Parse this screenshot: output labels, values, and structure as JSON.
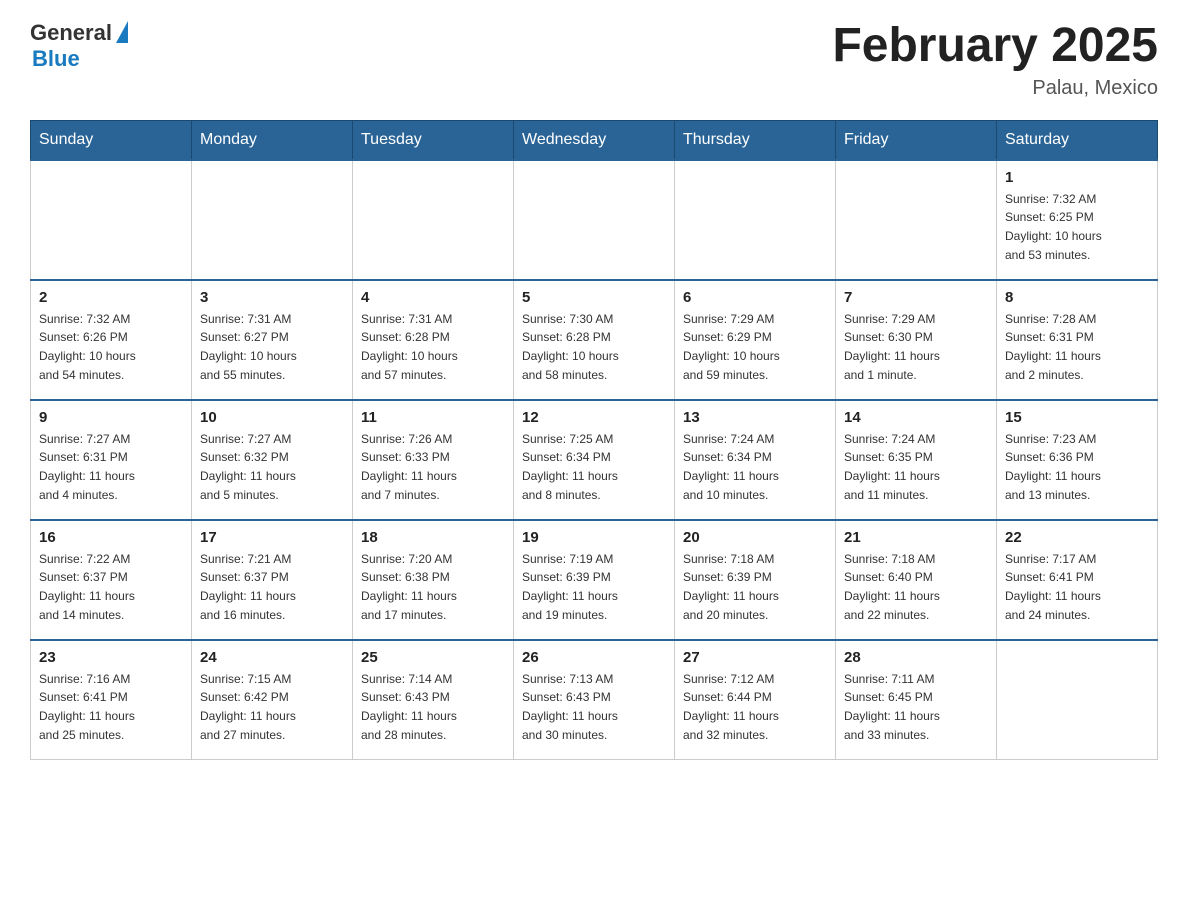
{
  "header": {
    "logo_general": "General",
    "logo_blue": "Blue",
    "month_title": "February 2025",
    "location": "Palau, Mexico"
  },
  "weekdays": [
    "Sunday",
    "Monday",
    "Tuesday",
    "Wednesday",
    "Thursday",
    "Friday",
    "Saturday"
  ],
  "weeks": [
    [
      {
        "day": "",
        "info": ""
      },
      {
        "day": "",
        "info": ""
      },
      {
        "day": "",
        "info": ""
      },
      {
        "day": "",
        "info": ""
      },
      {
        "day": "",
        "info": ""
      },
      {
        "day": "",
        "info": ""
      },
      {
        "day": "1",
        "info": "Sunrise: 7:32 AM\nSunset: 6:25 PM\nDaylight: 10 hours\nand 53 minutes."
      }
    ],
    [
      {
        "day": "2",
        "info": "Sunrise: 7:32 AM\nSunset: 6:26 PM\nDaylight: 10 hours\nand 54 minutes."
      },
      {
        "day": "3",
        "info": "Sunrise: 7:31 AM\nSunset: 6:27 PM\nDaylight: 10 hours\nand 55 minutes."
      },
      {
        "day": "4",
        "info": "Sunrise: 7:31 AM\nSunset: 6:28 PM\nDaylight: 10 hours\nand 57 minutes."
      },
      {
        "day": "5",
        "info": "Sunrise: 7:30 AM\nSunset: 6:28 PM\nDaylight: 10 hours\nand 58 minutes."
      },
      {
        "day": "6",
        "info": "Sunrise: 7:29 AM\nSunset: 6:29 PM\nDaylight: 10 hours\nand 59 minutes."
      },
      {
        "day": "7",
        "info": "Sunrise: 7:29 AM\nSunset: 6:30 PM\nDaylight: 11 hours\nand 1 minute."
      },
      {
        "day": "8",
        "info": "Sunrise: 7:28 AM\nSunset: 6:31 PM\nDaylight: 11 hours\nand 2 minutes."
      }
    ],
    [
      {
        "day": "9",
        "info": "Sunrise: 7:27 AM\nSunset: 6:31 PM\nDaylight: 11 hours\nand 4 minutes."
      },
      {
        "day": "10",
        "info": "Sunrise: 7:27 AM\nSunset: 6:32 PM\nDaylight: 11 hours\nand 5 minutes."
      },
      {
        "day": "11",
        "info": "Sunrise: 7:26 AM\nSunset: 6:33 PM\nDaylight: 11 hours\nand 7 minutes."
      },
      {
        "day": "12",
        "info": "Sunrise: 7:25 AM\nSunset: 6:34 PM\nDaylight: 11 hours\nand 8 minutes."
      },
      {
        "day": "13",
        "info": "Sunrise: 7:24 AM\nSunset: 6:34 PM\nDaylight: 11 hours\nand 10 minutes."
      },
      {
        "day": "14",
        "info": "Sunrise: 7:24 AM\nSunset: 6:35 PM\nDaylight: 11 hours\nand 11 minutes."
      },
      {
        "day": "15",
        "info": "Sunrise: 7:23 AM\nSunset: 6:36 PM\nDaylight: 11 hours\nand 13 minutes."
      }
    ],
    [
      {
        "day": "16",
        "info": "Sunrise: 7:22 AM\nSunset: 6:37 PM\nDaylight: 11 hours\nand 14 minutes."
      },
      {
        "day": "17",
        "info": "Sunrise: 7:21 AM\nSunset: 6:37 PM\nDaylight: 11 hours\nand 16 minutes."
      },
      {
        "day": "18",
        "info": "Sunrise: 7:20 AM\nSunset: 6:38 PM\nDaylight: 11 hours\nand 17 minutes."
      },
      {
        "day": "19",
        "info": "Sunrise: 7:19 AM\nSunset: 6:39 PM\nDaylight: 11 hours\nand 19 minutes."
      },
      {
        "day": "20",
        "info": "Sunrise: 7:18 AM\nSunset: 6:39 PM\nDaylight: 11 hours\nand 20 minutes."
      },
      {
        "day": "21",
        "info": "Sunrise: 7:18 AM\nSunset: 6:40 PM\nDaylight: 11 hours\nand 22 minutes."
      },
      {
        "day": "22",
        "info": "Sunrise: 7:17 AM\nSunset: 6:41 PM\nDaylight: 11 hours\nand 24 minutes."
      }
    ],
    [
      {
        "day": "23",
        "info": "Sunrise: 7:16 AM\nSunset: 6:41 PM\nDaylight: 11 hours\nand 25 minutes."
      },
      {
        "day": "24",
        "info": "Sunrise: 7:15 AM\nSunset: 6:42 PM\nDaylight: 11 hours\nand 27 minutes."
      },
      {
        "day": "25",
        "info": "Sunrise: 7:14 AM\nSunset: 6:43 PM\nDaylight: 11 hours\nand 28 minutes."
      },
      {
        "day": "26",
        "info": "Sunrise: 7:13 AM\nSunset: 6:43 PM\nDaylight: 11 hours\nand 30 minutes."
      },
      {
        "day": "27",
        "info": "Sunrise: 7:12 AM\nSunset: 6:44 PM\nDaylight: 11 hours\nand 32 minutes."
      },
      {
        "day": "28",
        "info": "Sunrise: 7:11 AM\nSunset: 6:45 PM\nDaylight: 11 hours\nand 33 minutes."
      },
      {
        "day": "",
        "info": ""
      }
    ]
  ]
}
